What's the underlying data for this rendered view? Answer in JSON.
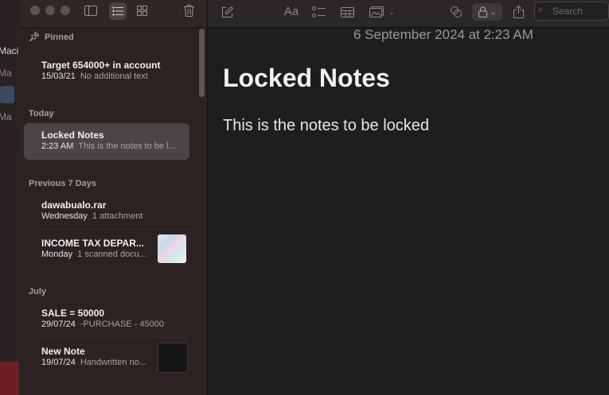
{
  "background_window": {
    "labels": [
      "Maci",
      "Ma",
      "Ma"
    ]
  },
  "sidebar": {
    "sections": {
      "pinned": "Pinned",
      "today": "Today",
      "previous": "Previous 7 Days",
      "july": "July"
    },
    "notes": [
      {
        "title": "Target 654000+ in account",
        "date": "15/03/21",
        "preview": "No additional text"
      },
      {
        "title": "Locked Notes",
        "date": "2:23 AM",
        "preview": "This is the notes to be l..."
      },
      {
        "title": "dawabualo.rar",
        "date": "Wednesday",
        "preview": "1 attachment"
      },
      {
        "title": "INCOME TAX DEPAR...",
        "date": "Monday",
        "preview": "1 scanned docu..."
      },
      {
        "title": "SALE = 50000",
        "date": "29/07/24",
        "preview": "-PURCHASE - 45000"
      },
      {
        "title": "New Note",
        "date": "19/07/24",
        "preview": "Handwritten no..."
      }
    ]
  },
  "toolbar": {
    "format_label": "Aa",
    "search_placeholder": "Search"
  },
  "editor": {
    "date": "6 September 2024 at 2:23 AM",
    "title": "Locked Notes",
    "body": "This is the notes to be locked"
  }
}
